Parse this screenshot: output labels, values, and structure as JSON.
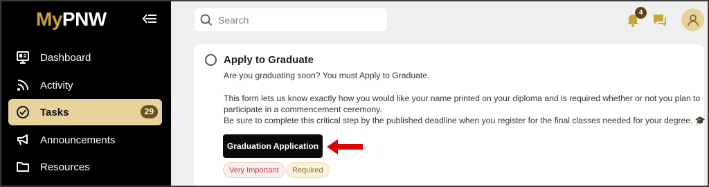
{
  "app": {
    "logo_my": "My",
    "logo_pnw": "PNW"
  },
  "sidebar": {
    "items": [
      {
        "label": "Dashboard",
        "icon": "dashboard-icon"
      },
      {
        "label": "Activity",
        "icon": "rss-icon"
      },
      {
        "label": "Tasks",
        "icon": "check-circle-icon",
        "badge": "29",
        "active": true
      },
      {
        "label": "Announcements",
        "icon": "megaphone-icon"
      },
      {
        "label": "Resources",
        "icon": "folder-icon"
      }
    ]
  },
  "header": {
    "search_placeholder": "Search",
    "notification_count": "4"
  },
  "task": {
    "title": "Apply to Graduate",
    "line1": "Are you graduating soon? You must Apply to Graduate.",
    "line2": "This form lets us know exactly how you would like your name printed on your diploma and is required whether or not you plan to",
    "line3": "participate in a commencement ceremony.",
    "line4": "Be sure to complete this critical step by the published deadline when you register for the final classes needed for your degree. 🎓",
    "button_label": "Graduation Application",
    "tags": [
      "Very Important",
      "Required"
    ]
  },
  "colors": {
    "brand_gold": "#c9a43b",
    "active_bg": "#e7d29b",
    "arrow_red": "#e00000"
  }
}
